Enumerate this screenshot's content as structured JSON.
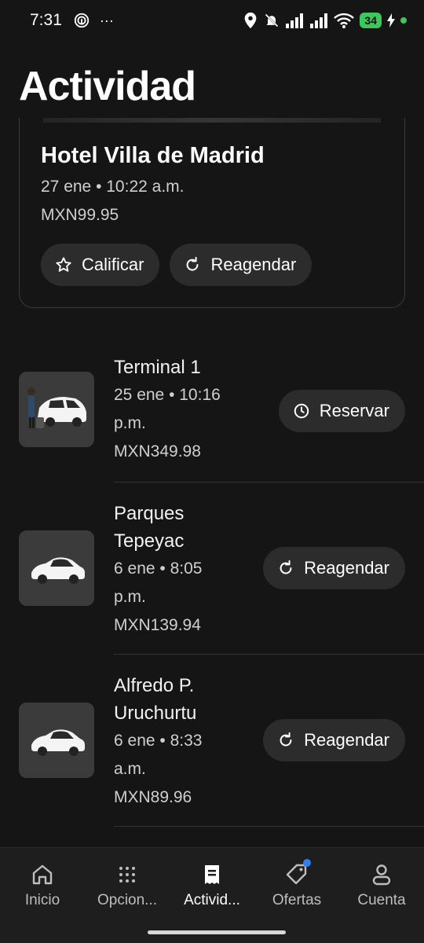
{
  "status_bar": {
    "time": "7:31",
    "dots": "···",
    "battery": "34"
  },
  "page_title": "Actividad",
  "featured_trip": {
    "name": "Hotel Villa de Madrid",
    "date": "27 ene • 10:22 a.m.",
    "price": "MXN99.95",
    "rate_label": "Calificar",
    "rebook_label": "Reagendar"
  },
  "trips": [
    {
      "name": "Terminal 1",
      "date_line1": "25 ene • 10:16",
      "date_line2": "p.m.",
      "price": "MXN349.98",
      "action": "Reservar",
      "action_icon": "clock-icon",
      "thumb": "van-with-passenger"
    },
    {
      "name_line1": "Parques",
      "name_line2": "Tepeyac",
      "date_line1": "6 ene • 8:05",
      "date_line2": "p.m.",
      "price": "MXN139.94",
      "action": "Reagendar",
      "action_icon": "refresh-icon",
      "thumb": "sedan"
    },
    {
      "name_line1": "Alfredo P.",
      "name_line2": "Uruchurtu",
      "date_line1": "6 ene • 8:33",
      "date_line2": "a.m.",
      "price": "MXN89.96",
      "action": "Reagendar",
      "action_icon": "refresh-icon",
      "thumb": "sedan"
    }
  ],
  "bottom_nav": [
    {
      "label": "Inicio",
      "icon": "home-icon"
    },
    {
      "label": "Opcion...",
      "icon": "grid-icon"
    },
    {
      "label": "Activid...",
      "icon": "receipt-icon",
      "active": true
    },
    {
      "label": "Ofertas",
      "icon": "tag-icon",
      "badge": true
    },
    {
      "label": "Cuenta",
      "icon": "person-icon"
    }
  ],
  "colors": {
    "background": "#151515",
    "pill": "#2c2c2c",
    "accent_badge": "#2e7cf6",
    "battery": "#3cc85a"
  }
}
